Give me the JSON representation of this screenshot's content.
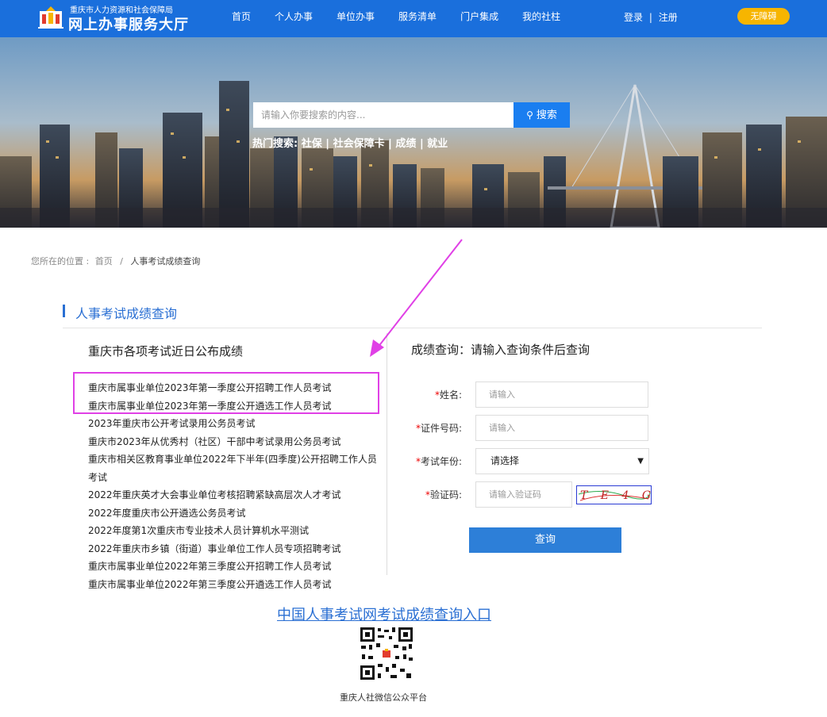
{
  "header": {
    "org_name": "重庆市人力资源和社会保障局",
    "site_title": "网上办事服务大厅",
    "nav": [
      "首页",
      "个人办事",
      "单位办事",
      "服务清单",
      "门户集成",
      "我的社柱"
    ],
    "login": "登录",
    "register": "注册",
    "auth_sep": "|",
    "barrier_free": "无障碍"
  },
  "banner": {
    "search_placeholder": "请输入你要搜索的内容...",
    "search_button": "搜索",
    "hot_label": "热门搜索:",
    "hot_items": [
      "社保",
      "社会保障卡",
      "成绩",
      "就业"
    ],
    "hot_sep": "|"
  },
  "breadcrumb": {
    "prefix": "您所在的位置 :",
    "home": "首页",
    "sep": "/",
    "current": "人事考试成绩查询"
  },
  "section": {
    "title": "人事考试成绩查询"
  },
  "left": {
    "title": "重庆市各项考试近日公布成绩",
    "items": [
      "重庆市属事业单位2023年第一季度公开招聘工作人员考试",
      "重庆市属事业单位2023年第一季度公开遴选工作人员考试",
      "2023年重庆市公开考试录用公务员考试",
      "重庆市2023年从优秀村（社区）干部中考试录用公务员考试",
      "重庆市相关区教育事业单位2022年下半年(四季度)公开招聘工作人员考试",
      "2022年重庆英才大会事业单位考核招聘紧缺高层次人才考试",
      "2022年度重庆市公开遴选公务员考试",
      "2022年度第1次重庆市专业技术人员计算机水平测试",
      "2022年重庆市乡镇（街道）事业单位工作人员专项招聘考试",
      "重庆市属事业单位2022年第三季度公开招聘工作人员考试",
      "重庆市属事业单位2022年第三季度公开遴选工作人员考试"
    ]
  },
  "form": {
    "title": "成绩查询：请输入查询条件后查询",
    "required_mark": "*",
    "name_label": "姓名:",
    "name_placeholder": "请输入",
    "id_label": "证件号码:",
    "id_placeholder": "请输入",
    "year_label": "考试年份:",
    "year_value": "请选择",
    "captcha_label": "验证码:",
    "captcha_placeholder": "请输入验证码",
    "captcha_text": "T E 4 G",
    "submit": "查询"
  },
  "footer": {
    "portal_link": "中国人事考试网考试成绩查询入口",
    "qr_caption": "重庆人社微信公众平台"
  },
  "colors": {
    "brand": "#1a6fdc",
    "accent": "#2a6fd3",
    "button": "#2d7fd8",
    "barrier": "#f7b500",
    "highlight": "#e040e6",
    "required": "#e00000"
  }
}
